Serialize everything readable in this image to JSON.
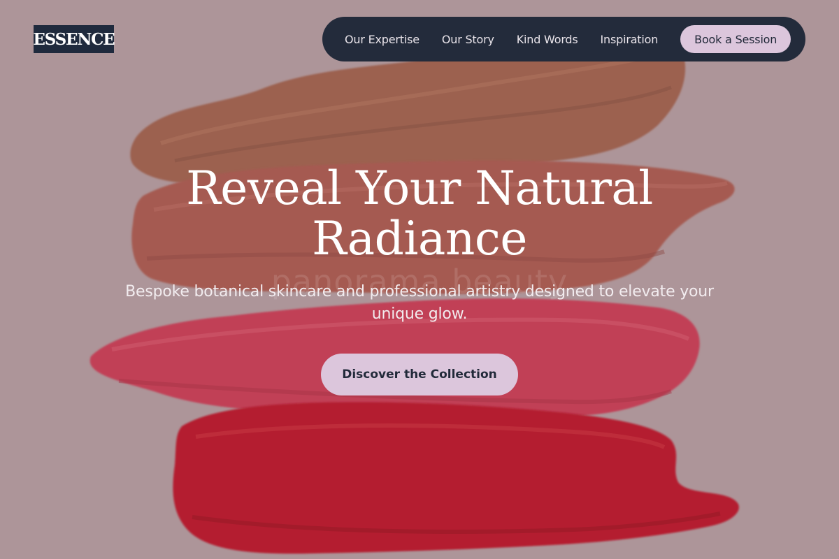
{
  "brand": {
    "logo_text": "ESSENCE"
  },
  "nav": {
    "links": [
      {
        "label": "Our Expertise"
      },
      {
        "label": "Our Story"
      },
      {
        "label": "Kind Words"
      },
      {
        "label": "Inspiration"
      }
    ],
    "cta_label": "Book a Session"
  },
  "hero": {
    "title_line1": "Reveal Your Natural",
    "title_line2": "Radiance",
    "subtitle_line1": "Bespoke botanical skincare and professional artistry designed to elevate your",
    "subtitle_line2": "unique glow.",
    "cta_label": "Discover the Collection",
    "watermark_text": "panorama beauty"
  },
  "colors": {
    "background": "#ae9699",
    "nav_background": "#232b3b",
    "accent": "#dcc6dc",
    "swatch_bronze": "#9c5a44",
    "swatch_terracotta": "#a65349",
    "swatch_raspberry": "#c5354f",
    "swatch_crimson": "#b7101f"
  }
}
